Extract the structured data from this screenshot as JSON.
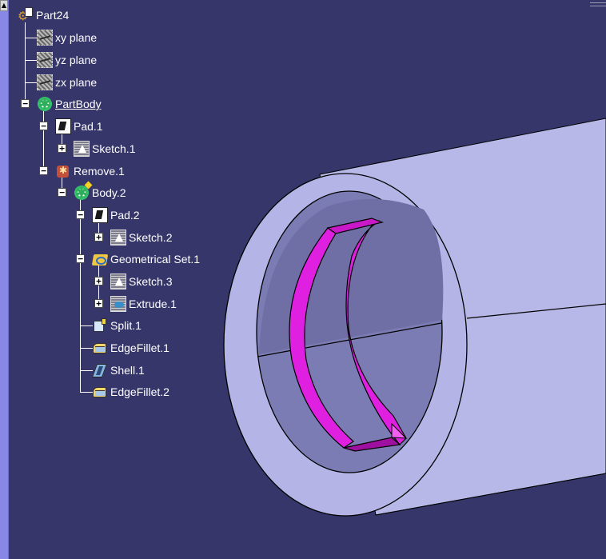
{
  "window": {
    "scroll_up_label": "▲"
  },
  "tree": {
    "root": {
      "label": "Part24",
      "icon": "part-icon"
    },
    "planes": [
      {
        "label": "xy plane",
        "icon": "plane-icon"
      },
      {
        "label": "yz plane",
        "icon": "plane-icon"
      },
      {
        "label": "zx plane",
        "icon": "plane-icon"
      }
    ],
    "part_body": {
      "label": "PartBody",
      "icon": "body-gear-icon",
      "expander": "−"
    },
    "pad1": {
      "label": "Pad.1",
      "icon": "pad-icon",
      "expander": "−"
    },
    "sketch1": {
      "label": "Sketch.1",
      "icon": "sketch-icon",
      "expander": "+"
    },
    "remove1": {
      "label": "Remove.1",
      "icon": "remove-icon",
      "expander": "−"
    },
    "body2": {
      "label": "Body.2",
      "icon": "body-gear-icon",
      "expander": "−"
    },
    "pad2": {
      "label": "Pad.2",
      "icon": "pad-icon",
      "expander": "−"
    },
    "sketch2": {
      "label": "Sketch.2",
      "icon": "sketch-icon",
      "expander": "+"
    },
    "geoset1": {
      "label": "Geometrical Set.1",
      "icon": "geometrical-set-icon",
      "expander": "−"
    },
    "sketch3": {
      "label": "Sketch.3",
      "icon": "sketch-icon",
      "expander": "+"
    },
    "extrude1": {
      "label": "Extrude.1",
      "icon": "extrude-icon",
      "expander": "+"
    },
    "split1": {
      "label": "Split.1",
      "icon": "split-icon"
    },
    "edgefillet1": {
      "label": "EdgeFillet.1",
      "icon": "edge-fillet-icon"
    },
    "shell1": {
      "label": "Shell.1",
      "icon": "shell-icon"
    },
    "edgefillet2": {
      "label": "EdgeFillet.2",
      "icon": "edge-fillet-icon"
    }
  },
  "model": {
    "tube_color": "#b8b8e8",
    "tube_shadow": "#9a9ad0",
    "slot_color": "#e020e0",
    "background_color": "#36366b"
  }
}
